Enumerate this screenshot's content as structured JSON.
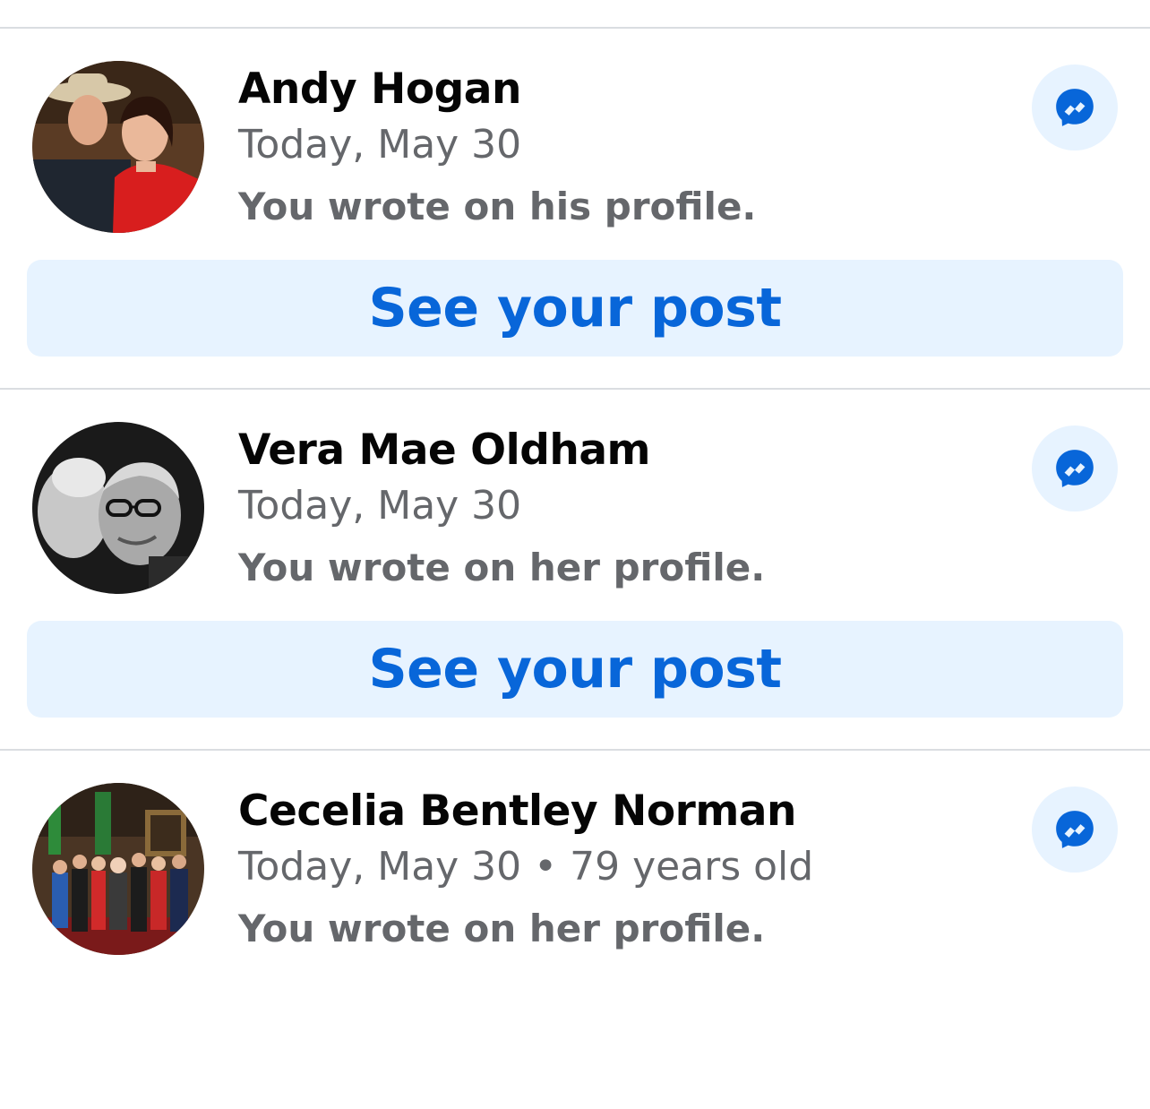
{
  "entries": [
    {
      "name": "Andy Hogan",
      "date": "Today, May 30",
      "note": "You wrote on his profile.",
      "action_label": "See your post",
      "messenger_icon": "messenger-icon"
    },
    {
      "name": "Vera Mae Oldham",
      "date": "Today, May 30",
      "note": "You wrote on her profile.",
      "action_label": "See your post",
      "messenger_icon": "messenger-icon"
    },
    {
      "name": "Cecelia Bentley Norman",
      "date": "Today, May 30 • 79 years old",
      "note": "You wrote on her profile.",
      "messenger_icon": "messenger-icon"
    }
  ],
  "colors": {
    "accent": "#0866d9",
    "button_bg": "#e7f3ff",
    "primary_text": "#050505",
    "secondary_text": "#65676b",
    "divider": "#dadde1"
  }
}
